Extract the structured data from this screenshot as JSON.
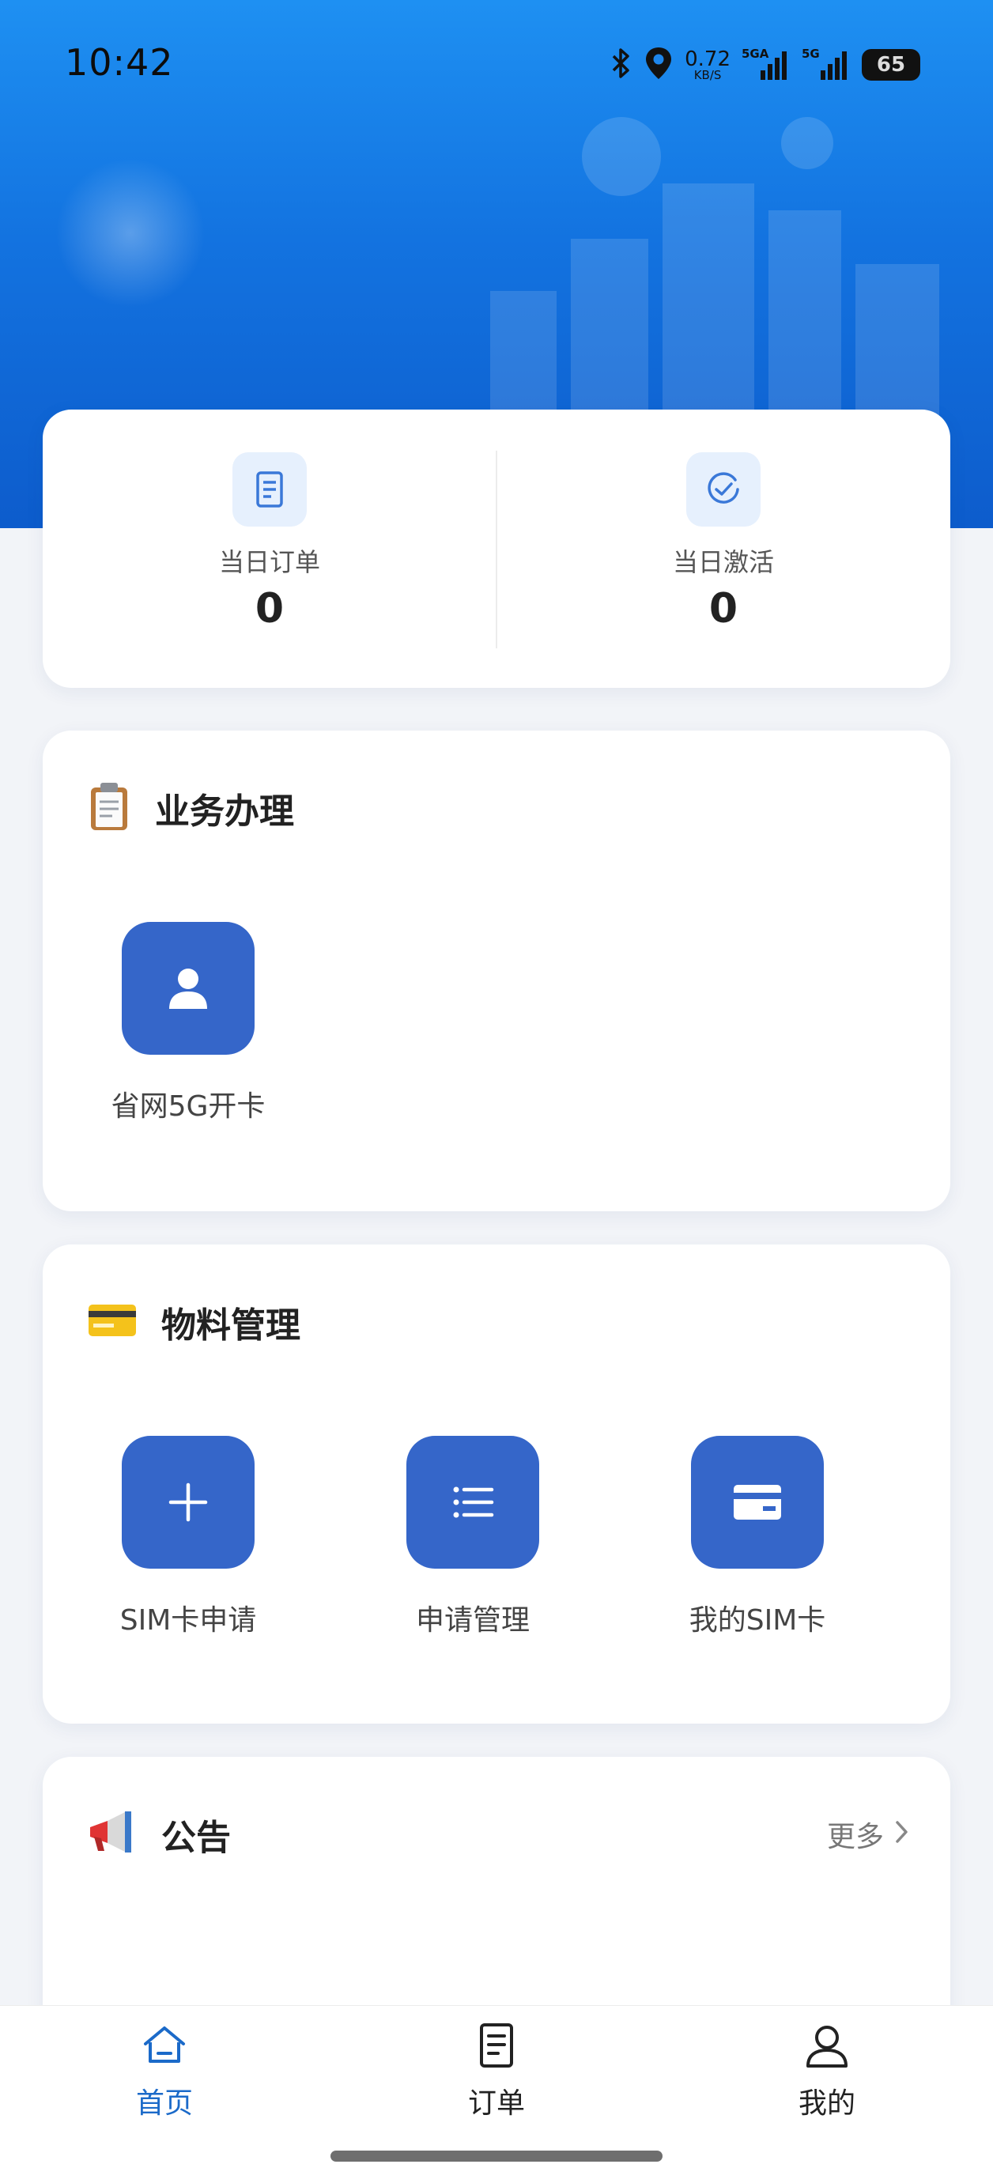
{
  "status_bar": {
    "time": "10:42",
    "net_speed_value": "0.72",
    "net_speed_unit": "KB/S",
    "signal_1": "5GA",
    "signal_2": "5G",
    "battery": "65"
  },
  "stats": [
    {
      "label": "当日订单",
      "value": "0",
      "icon": "document-icon"
    },
    {
      "label": "当日激活",
      "value": "0",
      "icon": "check-circle-icon"
    }
  ],
  "business": {
    "title": "业务办理",
    "icon": "clipboard-icon",
    "items": [
      {
        "label": "省网5G开卡",
        "icon": "user-icon"
      }
    ]
  },
  "materials": {
    "title": "物料管理",
    "icon": "credit-card-icon",
    "items": [
      {
        "label": "SIM卡申请",
        "icon": "plus-icon"
      },
      {
        "label": "申请管理",
        "icon": "list-icon"
      },
      {
        "label": "我的SIM卡",
        "icon": "card-icon"
      }
    ]
  },
  "announcements": {
    "title": "公告",
    "icon": "megaphone-icon",
    "more_label": "更多"
  },
  "tabbar": {
    "items": [
      {
        "label": "首页",
        "icon": "home-icon",
        "active": true
      },
      {
        "label": "订单",
        "icon": "document-icon",
        "active": false
      },
      {
        "label": "我的",
        "icon": "profile-icon",
        "active": false
      }
    ]
  },
  "colors": {
    "primary": "#3566c9",
    "header_top": "#1e90f2",
    "header_bottom": "#0d5ccc",
    "active_tab": "#1b6ac9"
  }
}
